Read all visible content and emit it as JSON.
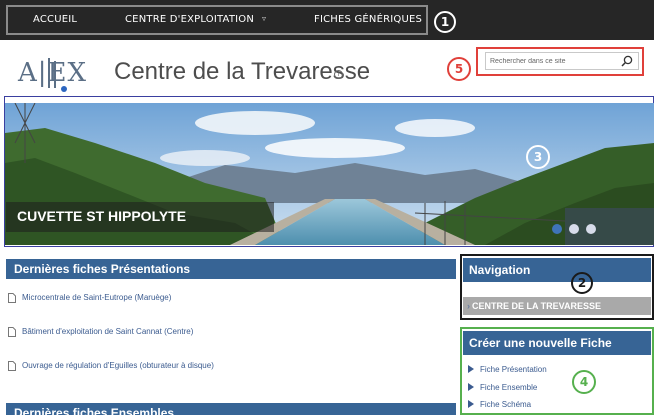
{
  "topnav": {
    "items": [
      "ACCUEIL",
      "CENTRE D'EXPLOITATION",
      "FICHES GÉNÉRIQUES"
    ]
  },
  "annotations": [
    "1",
    "2",
    "3",
    "4",
    "5"
  ],
  "header": {
    "logo_text": "A|EX",
    "site_title": "Centre de la Trevaresse",
    "search_placeholder": "Rechercher dans ce site"
  },
  "hero": {
    "caption": "CUVETTE ST HIPPOLYTE",
    "slide_count": 3,
    "active_slide": 1
  },
  "presentations": {
    "title": "Dernières fiches Présentations",
    "items": [
      "Microcentrale de Saint-Eutrope (Maruège)",
      "Bâtiment d'exploitation de Saint Cannat (Centre)",
      "Ouvrage de régulation d'Eguilles (obturateur à disque)"
    ]
  },
  "ensembles": {
    "title": "Dernières fiches Ensembles"
  },
  "navigation": {
    "title": "Navigation",
    "items": [
      "CENTRE DE LA TREVARESSE"
    ]
  },
  "create": {
    "title": "Créer une nouvelle Fiche",
    "items": [
      "Fiche Présentation",
      "Fiche Ensemble",
      "Fiche Schéma"
    ]
  },
  "colors": {
    "topnav_bg": "#262626",
    "header_blue": "#376495",
    "link_blue": "#3b5b8f",
    "annotation_red": "#e0403a",
    "annotation_green": "#56b04e",
    "annotation_blue": "#3a3fa0"
  }
}
